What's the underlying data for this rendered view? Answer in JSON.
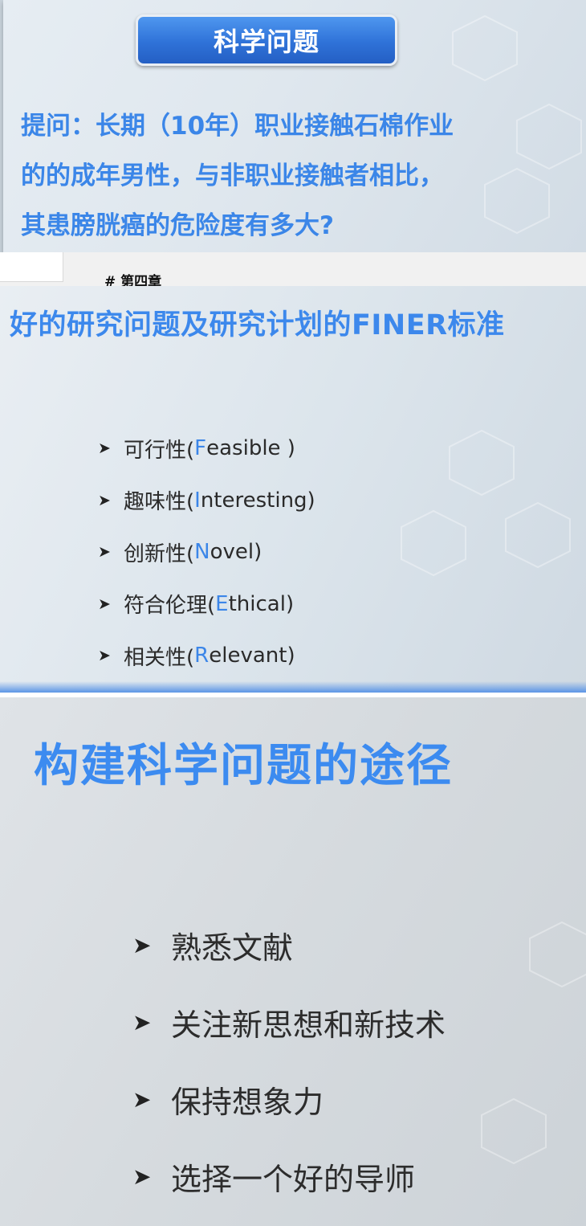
{
  "slide1": {
    "title": "科学问题",
    "question_lines": [
      "提问：长期（10年）职业接触石棉作业",
      "的的成年男性，与非职业接触者相比，",
      "其患膀胱癌的危险度有多大?"
    ]
  },
  "chapter_heading": "# 第四章",
  "slide2": {
    "title": "好的研究问题及研究计划的FINER标准",
    "items": [
      {
        "prefix": "可行性(",
        "letter": "F",
        "rest": "easible )"
      },
      {
        "prefix": "趣味性(",
        "letter": "I",
        "rest": "nteresting)"
      },
      {
        "prefix": "创新性(",
        "letter": "N",
        "rest": "ovel)"
      },
      {
        "prefix": "符合伦理(",
        "letter": "E",
        "rest": "thical)"
      },
      {
        "prefix": "相关性(",
        "letter": "R",
        "rest": "elevant)"
      }
    ]
  },
  "slide3": {
    "title": "构建科学问题的途径",
    "items": [
      "熟悉文献",
      "关注新思想和新技术",
      "保持想象力",
      "选择一个好的导师"
    ]
  },
  "bullet_glyph": "➤",
  "colors": {
    "accent": "#3b86e8",
    "pill": "#2f72d8"
  }
}
